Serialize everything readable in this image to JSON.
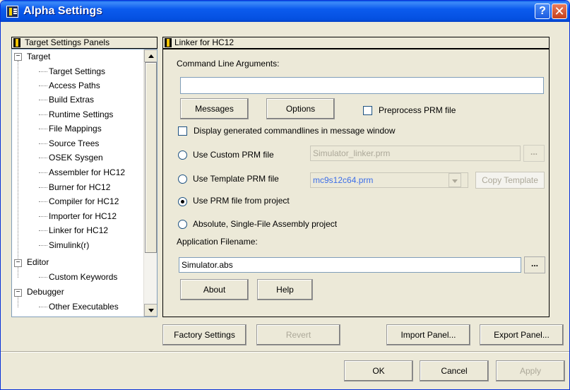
{
  "window": {
    "title": "Alpha Settings",
    "help_label": "?",
    "close_label": "✕"
  },
  "tree": {
    "header": "Target Settings Panels",
    "items": [
      {
        "label": "Target",
        "level": 1,
        "expander": "−"
      },
      {
        "label": "Target Settings",
        "level": 2
      },
      {
        "label": "Access Paths",
        "level": 2
      },
      {
        "label": "Build Extras",
        "level": 2
      },
      {
        "label": "Runtime Settings",
        "level": 2
      },
      {
        "label": "File Mappings",
        "level": 2
      },
      {
        "label": "Source Trees",
        "level": 2
      },
      {
        "label": "OSEK Sysgen",
        "level": 2
      },
      {
        "label": "Assembler for HC12",
        "level": 2
      },
      {
        "label": "Burner for HC12",
        "level": 2
      },
      {
        "label": "Compiler for HC12",
        "level": 2
      },
      {
        "label": "Importer for HC12",
        "level": 2
      },
      {
        "label": "Linker for HC12",
        "level": 2
      },
      {
        "label": "Simulink(r)",
        "level": 2
      },
      {
        "label": "Editor",
        "level": 1,
        "expander": "−"
      },
      {
        "label": "Custom Keywords",
        "level": 2
      },
      {
        "label": "Debugger",
        "level": 1,
        "expander": "−"
      },
      {
        "label": "Other Executables",
        "level": 2
      }
    ]
  },
  "panel": {
    "header": "Linker for HC12",
    "cmd_args_label": "Command Line Arguments:",
    "cmd_args_value": "",
    "messages_button": "Messages",
    "options_button": "Options",
    "preprocess_label": "Preprocess PRM file",
    "display_cmd_label": "Display generated commandlines in message window",
    "custom_prm_label": "Use Custom PRM file",
    "custom_prm_value": "Simulator_linker.prm",
    "browse_label": "...",
    "template_prm_label": "Use Template PRM file",
    "template_prm_value": "mc9s12c64.prm",
    "copy_template_button": "Copy Template",
    "project_prm_label": "Use PRM file from project",
    "absolute_label": "Absolute, Single-File Assembly project",
    "app_filename_label": "Application Filename:",
    "app_filename_value": "Simulator.abs",
    "about_button": "About",
    "help_button": "Help"
  },
  "footer": {
    "factory_settings": "Factory Settings",
    "revert": "Revert",
    "import_panel": "Import Panel...",
    "export_panel": "Export Panel...",
    "ok": "OK",
    "cancel": "Cancel",
    "apply": "Apply"
  },
  "colors": {
    "titlebar": "#0a5be8",
    "face": "#ece9d8",
    "link_blue": "#3c6ee8"
  }
}
